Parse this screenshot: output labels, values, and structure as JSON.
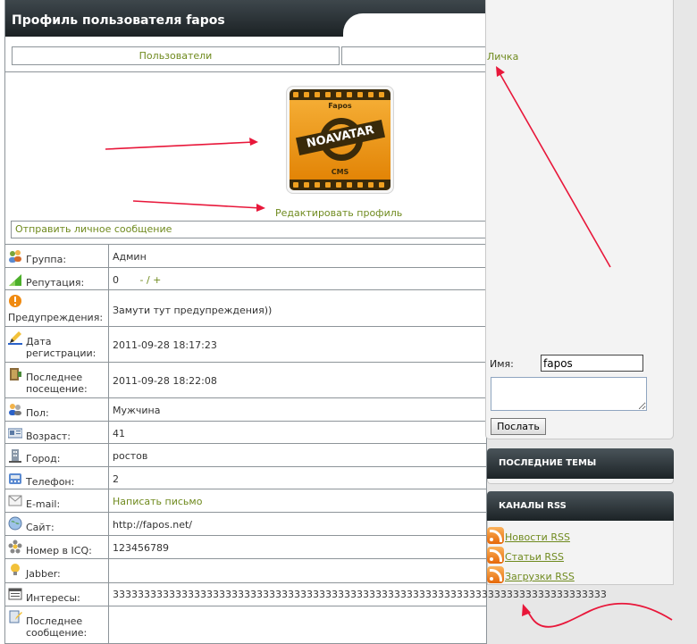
{
  "page_title": "Профиль пользователя fapos",
  "nav": {
    "users": "Пользователи"
  },
  "avatar": {
    "top_text": "Fapos",
    "main_text": "NOAVATAR",
    "bottom_text": "CMS"
  },
  "edit_profile": "Редактировать профиль",
  "send_pm": "Отправить личное сообщение",
  "info_rows": [
    {
      "label": "Группа:",
      "value": "Админ",
      "icon": "users-icon"
    },
    {
      "label": "Репутация:",
      "value": "0",
      "extra": "- / +",
      "icon": "signal-icon"
    },
    {
      "label": "Предупреждения:",
      "value": "Замути тут предупреждения))",
      "icon": "warning-icon"
    },
    {
      "label": "Дата регистрации:",
      "value": "2011-09-28 18:17:23",
      "icon": "pencil-icon"
    },
    {
      "label": "Последнее посещение:",
      "value": "2011-09-28 18:22:08",
      "icon": "door-icon"
    },
    {
      "label": "Пол:",
      "value": "Мужчина",
      "icon": "gender-icon"
    },
    {
      "label": "Возраст:",
      "value": "41",
      "icon": "id-card-icon"
    },
    {
      "label": "Город:",
      "value": "ростов",
      "icon": "building-icon"
    },
    {
      "label": "Телефон:",
      "value": "2",
      "icon": "phone-icon"
    },
    {
      "label": "E-mail:",
      "value": "Написать письмо",
      "icon": "email-icon"
    },
    {
      "label": "Сайт:",
      "value": "http://fapos.net/",
      "icon": "globe-icon"
    },
    {
      "label": "Номер в ICQ:",
      "value": "123456789",
      "icon": "icq-flower-icon"
    },
    {
      "label": "Jabber:",
      "value": "",
      "icon": "bulb-icon"
    },
    {
      "label": "Интересы:",
      "value": "",
      "icon": "window-icon"
    },
    {
      "label": "Последнее сообщение:",
      "value": "",
      "icon": "edit-doc-icon"
    }
  ],
  "interests_overflow": "3333333333333333333333333333333333333333333333333333333333333333333333333333333",
  "sidebar": {
    "lichka": "Личка",
    "name_label": "Имя:",
    "name_value": "fapos",
    "send_button": "Послать",
    "latest_topics_title": "ПОСЛЕДНИЕ ТЕМЫ",
    "rss_title": "КАНАЛЫ RSS",
    "rss_items": [
      "Новости RSS",
      "Статьи RSS",
      "Загрузки RSS"
    ]
  },
  "colors": {
    "link": "#6f8a1e",
    "header_dark": "#1b2124",
    "annotation_arrow": "#e8173a"
  }
}
